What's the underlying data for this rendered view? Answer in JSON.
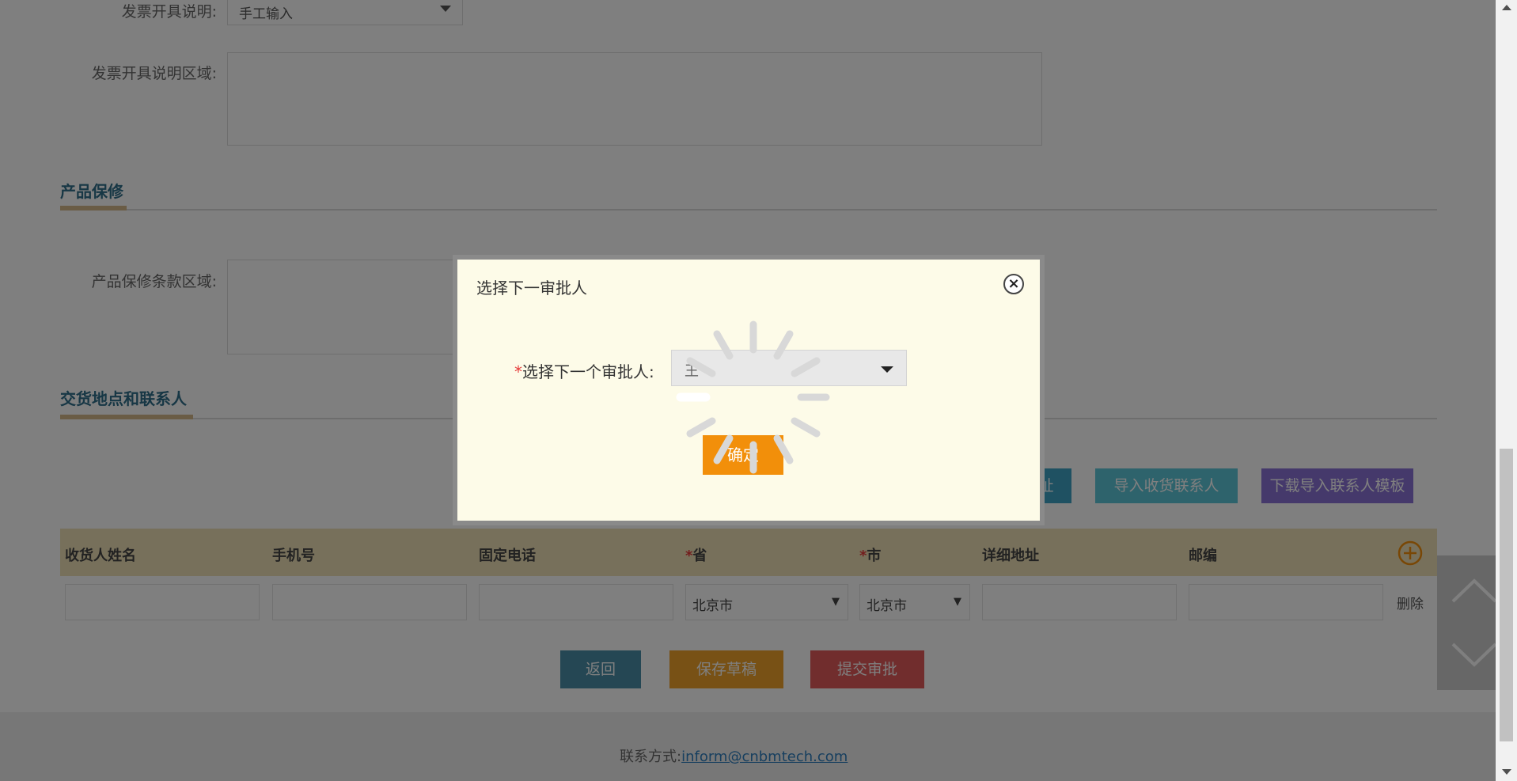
{
  "invoice": {
    "desc_label": "发票开具说明:",
    "desc_value": "手工输入",
    "area_label": "发票开具说明区域:"
  },
  "warranty": {
    "section_title": "产品保修",
    "area_label": "产品保修条款区域:"
  },
  "delivery": {
    "section_title": "交货地点和联系人",
    "btn_partial_address": "址",
    "btn_import_contacts": "导入收货联系人",
    "btn_download_template": "下载导入联系人模板"
  },
  "table": {
    "headers": [
      "收货人姓名",
      "手机号",
      "固定电话",
      "省",
      "市",
      "详细地址",
      "邮编"
    ],
    "row": {
      "province": "北京市",
      "city": "北京市",
      "delete": "删除"
    }
  },
  "actions": {
    "back": "返回",
    "save_draft": "保存草稿",
    "submit": "提交审批"
  },
  "footer": {
    "contact_label": "联系方式:",
    "email": "inform@cnbmtech.com"
  },
  "dialog": {
    "title": "选择下一审批人",
    "required_mark": "*",
    "field_label": "选择下一个审批人:",
    "select_value": "王",
    "confirm": "确定"
  },
  "colors": {
    "btn_blue": "#3fa3c5",
    "btn_teal": "#5dc6d8",
    "btn_purple": "#8a73d6",
    "btn_back": "#4a8fa8",
    "btn_save": "#f0a22b",
    "btn_submit": "#e25a5a",
    "dialog_confirm": "#f28f0a",
    "overlay": "rgba(0,0,0,0.5)"
  },
  "icons": {
    "close": "close-icon",
    "add": "plus-circle-icon",
    "scroll_top": "chevron-up-icon",
    "scroll_bottom": "chevron-down-icon",
    "loading": "spinner-icon"
  }
}
